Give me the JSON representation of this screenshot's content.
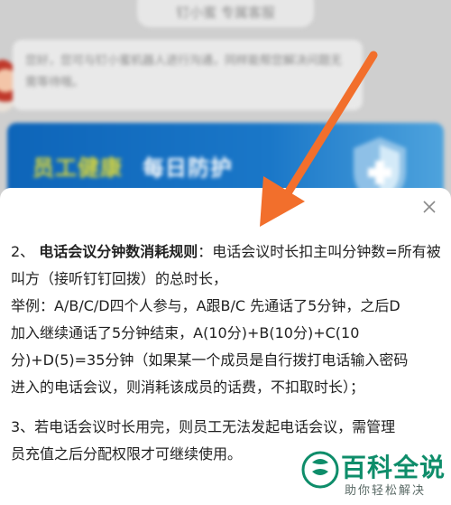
{
  "background": {
    "title_pill": "钉小蜜 专属客服",
    "chat_message": "您好，您可与钉小蜜机器人进行沟通，同样能帮您解决问题无需等待哦。",
    "banner": {
      "text1": "员工健康",
      "text2": "每日防护"
    }
  },
  "sheet": {
    "close_icon": "close-icon",
    "para1_prefix": "2、",
    "para1_bold": "电话会议分钟数消耗规则",
    "para1_rest": "：电话会议时长扣主叫分钟数=所有被叫方（接听钉钉回拨）的总时长，",
    "para1_example_lines": [
      "举例：A/B/C/D四个人参与，A跟B/C 先通话了5分钟，之后D",
      "加入继续通话了5分钟结束，A(10分)+B(10分)+C(10",
      "分)+D(5)=35分钟（如果某一个成员是自行拨打电话输入密码",
      "进入的电话会议，则消耗该成员的话费，不扣取时长）；"
    ],
    "para2_lines": [
      "3、若电话会议时长用完，则员工无法发起电话会议，需管理",
      "员充值之后分配权限才可继续使用。"
    ]
  },
  "overlay": {
    "arrow_color": "#f26f2c"
  },
  "watermark": {
    "title": "百科全说",
    "subtitle": "助你轻松解决",
    "color": "#0e8d6a"
  }
}
